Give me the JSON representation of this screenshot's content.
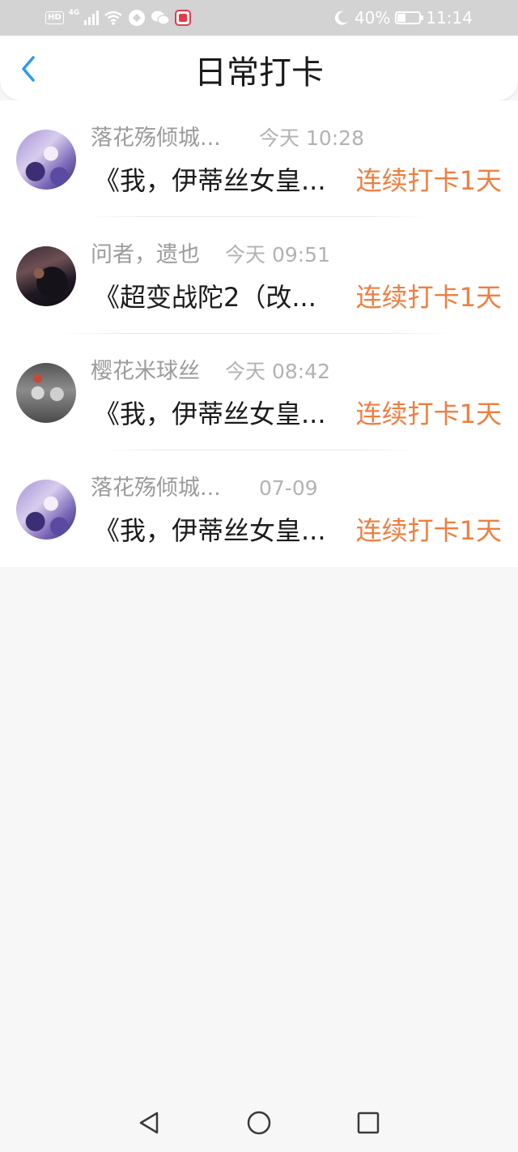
{
  "status_bar": {
    "hd": "HD",
    "network": "4G",
    "battery": "40%",
    "battery_level": 0.4,
    "time": "11:14"
  },
  "header": {
    "title": "日常打卡"
  },
  "items": [
    {
      "user": "落花殇倾城...",
      "time": "今天 10:28",
      "title": "《我，伊蒂丝女皇...",
      "streak": "连续打卡1天"
    },
    {
      "user": "问者，遗也",
      "time": "今天 09:51",
      "title": "《超变战陀2（改...",
      "streak": "连续打卡1天"
    },
    {
      "user": "樱花米球丝",
      "time": "今天 08:42",
      "title": "《我，伊蒂丝女皇...",
      "streak": "连续打卡1天"
    },
    {
      "user": "落花殇倾城...",
      "time": "07-09",
      "title": "《我，伊蒂丝女皇...",
      "streak": "连续打卡1天"
    }
  ],
  "colors": {
    "accent": "#2c9af0",
    "streak": "#ef7e3f"
  }
}
